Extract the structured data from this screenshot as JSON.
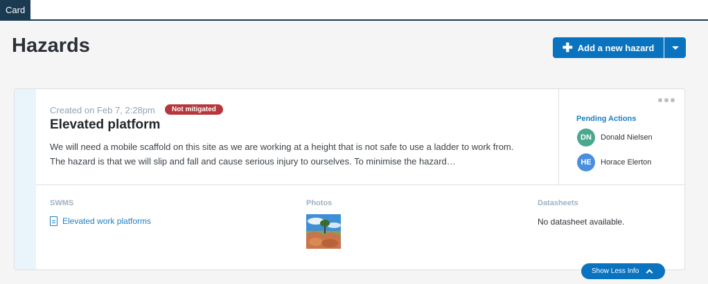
{
  "tab": {
    "label": "Card"
  },
  "page": {
    "title": "Hazards"
  },
  "toolbar": {
    "add_label": "Add a new hazard",
    "plus_icon": "plus-icon",
    "dropdown_icon": "caret-down-icon"
  },
  "hazard": {
    "created": "Created on Feb 7, 2:28pm",
    "status": "Not mitigated",
    "title": "Elevated platform",
    "description": "We will need a mobile scaffold on this site as we are working at a height that is not safe to use a ladder to work from. The hazard is that we will slip and fall and cause serious injury to ourselves. To minimise the hazard…",
    "menu_icon": "more-horizontal-icon"
  },
  "pending": {
    "label": "Pending Actions",
    "people": [
      {
        "initials": "DN",
        "name": "Donald Nielsen",
        "color": "#4aa88f"
      },
      {
        "initials": "HE",
        "name": "Horace Elerton",
        "color": "#4a8fdd"
      }
    ]
  },
  "swms": {
    "label": "SWMS",
    "link": "Elevated work platforms",
    "icon": "document-icon"
  },
  "photos": {
    "label": "Photos"
  },
  "datasheets": {
    "label": "Datasheets",
    "empty": "No datasheet available."
  },
  "footer": {
    "show_less": "Show Less Info",
    "icon": "chevron-up-icon"
  },
  "colors": {
    "primary": "#0a73c0",
    "badge": "#b5373b",
    "nav": "#1a3a52",
    "link": "#1c7ec3"
  }
}
